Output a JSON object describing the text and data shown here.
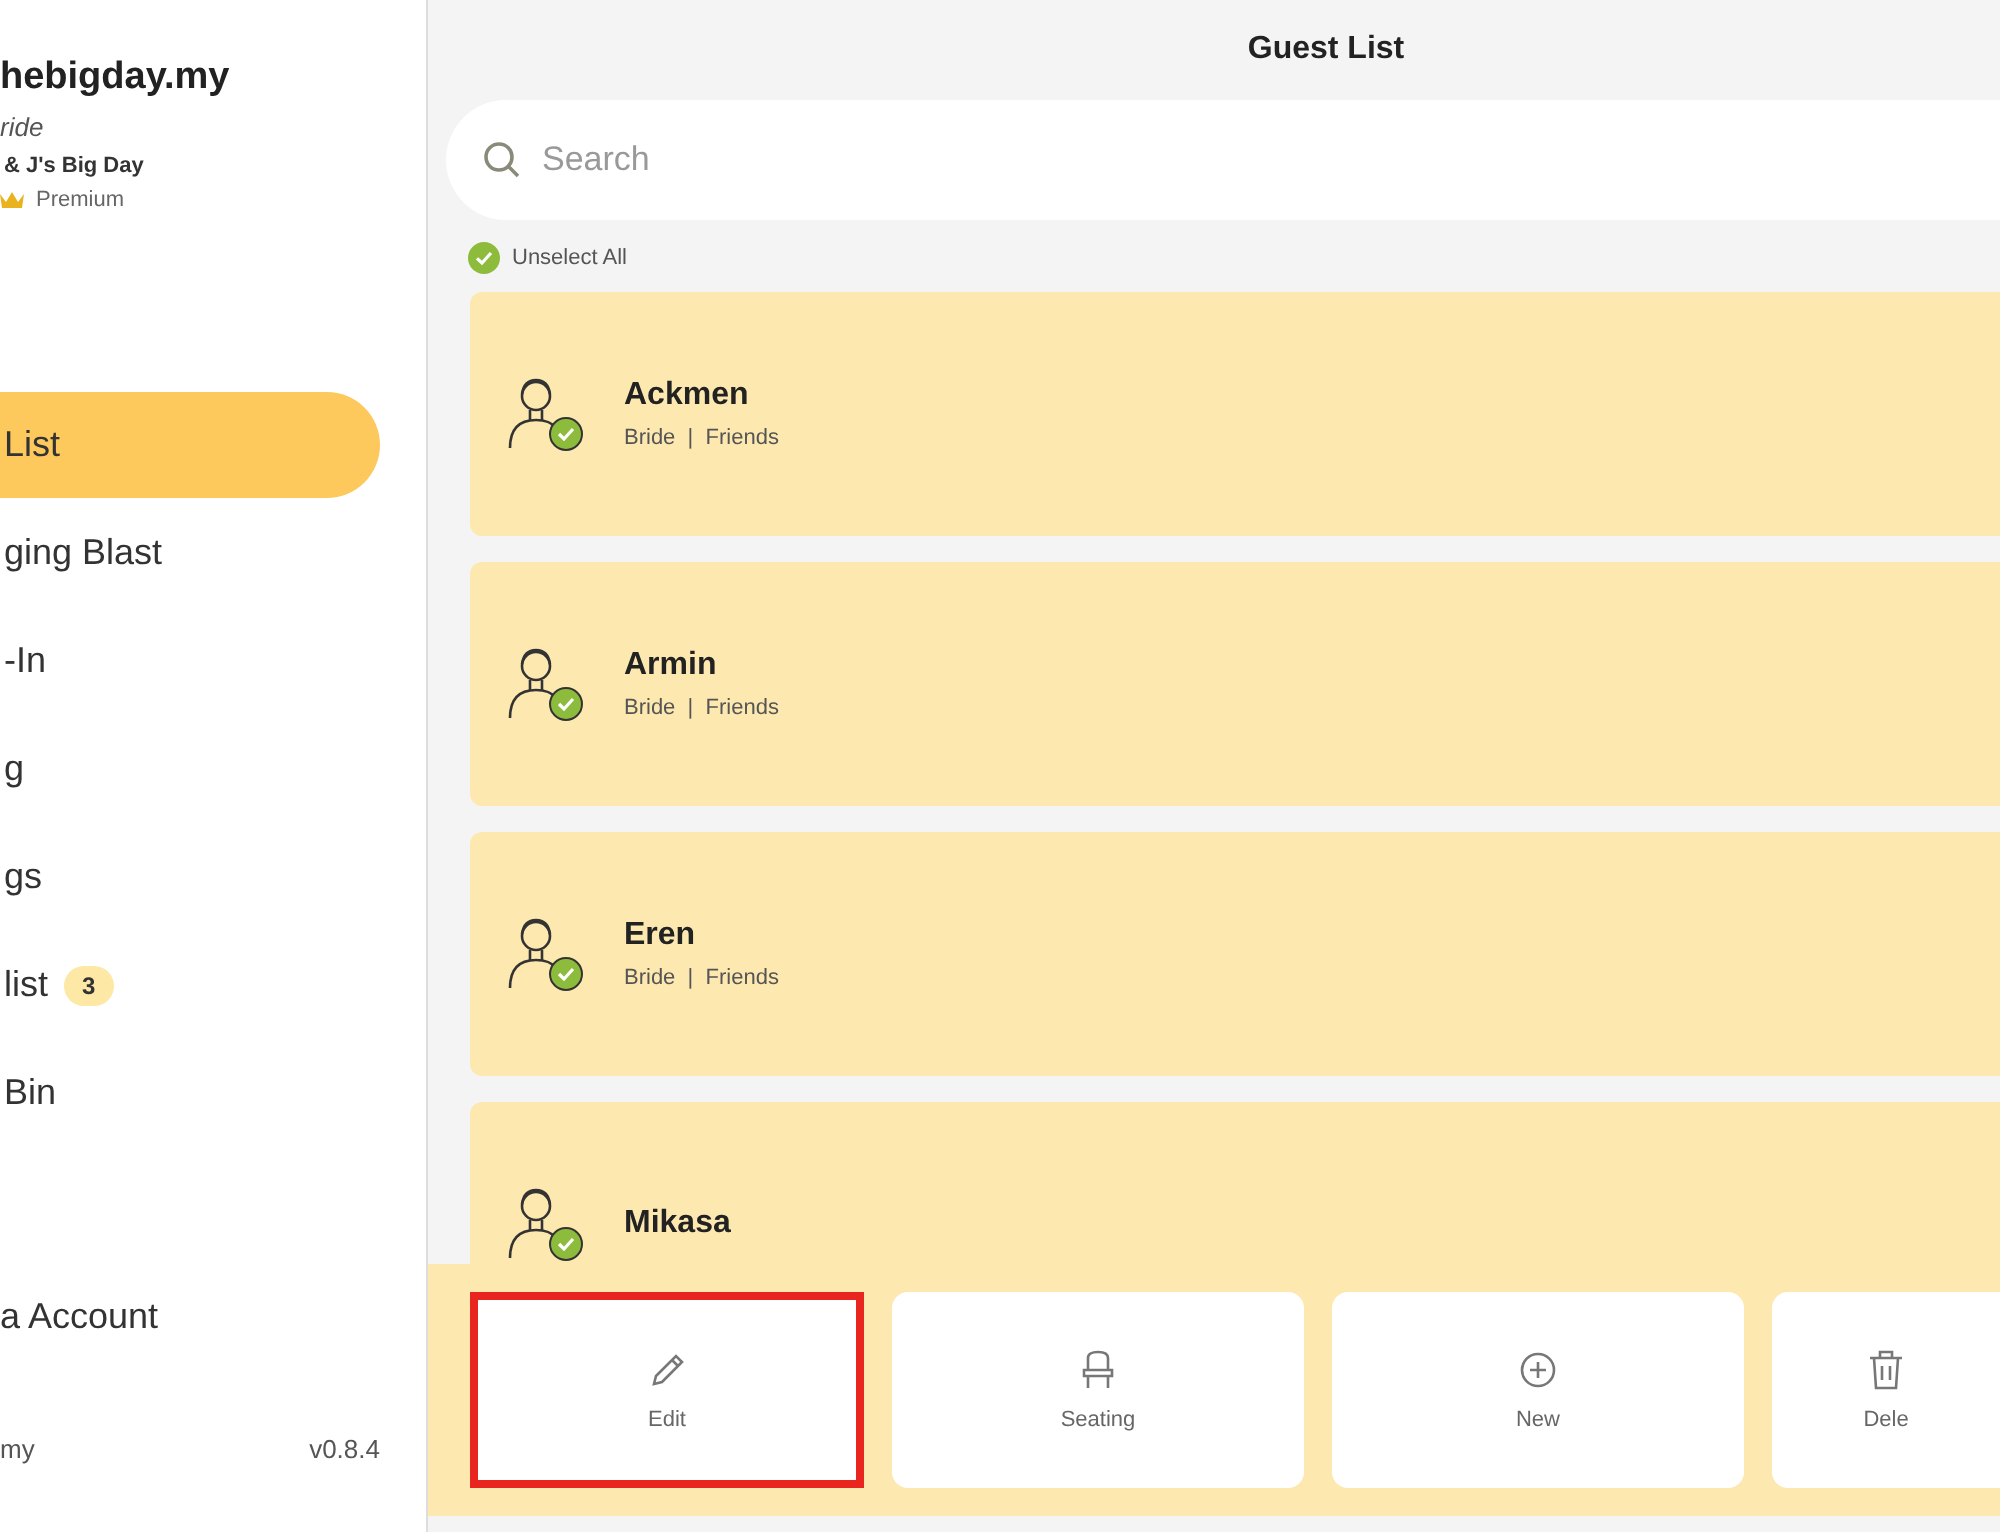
{
  "sidebar": {
    "brand": "hebigday.my",
    "role": "ride",
    "event": "& J's Big Day",
    "plan": "Premium",
    "items": [
      {
        "label": "List",
        "selected": true
      },
      {
        "label": "ging Blast",
        "selected": false
      },
      {
        "label": "-In",
        "selected": false
      },
      {
        "label": "g",
        "selected": false
      },
      {
        "label": "gs",
        "selected": false
      },
      {
        "label": "list",
        "selected": false,
        "badge": "3"
      },
      {
        "label": "Bin",
        "selected": false
      }
    ],
    "account": "a Account",
    "footer_left": "my",
    "version": "v0.8.4"
  },
  "main": {
    "title": "Guest List",
    "search": {
      "placeholder": "Search"
    },
    "unselect_all": "Unselect All",
    "guests": [
      {
        "name": "Ackmen",
        "tags": "Bride  |  Friends",
        "checked": true
      },
      {
        "name": "Armin",
        "tags": "Bride  |  Friends",
        "checked": true
      },
      {
        "name": "Eren",
        "tags": "Bride  |  Friends",
        "checked": true
      },
      {
        "name": "Mikasa",
        "checked": true
      }
    ],
    "actions": [
      {
        "kind": "edit",
        "label": "Edit",
        "highlighted": true
      },
      {
        "kind": "seating",
        "label": "Seating",
        "highlighted": false
      },
      {
        "kind": "new",
        "label": "New",
        "highlighted": false
      },
      {
        "kind": "delete",
        "label": "Dele",
        "highlighted": false
      }
    ]
  }
}
